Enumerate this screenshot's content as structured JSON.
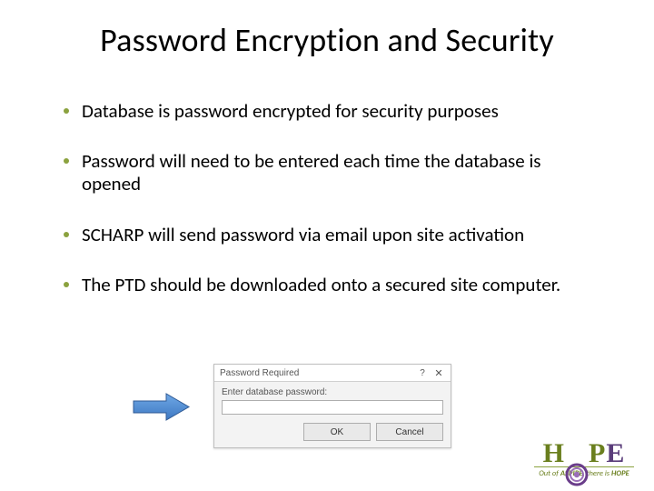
{
  "title": "Password Encryption and Security",
  "bullets": [
    "Database is password encrypted for security purposes",
    "Password will need to be entered each time the database is opened",
    "SCHARP will send password via email upon site activation",
    "The PTD should be downloaded onto a secured site computer."
  ],
  "dialog": {
    "title": "Password Required",
    "label": "Enter database password:",
    "ok": "OK",
    "cancel": "Cancel"
  },
  "logo": {
    "word_h": "H",
    "word_p": "P",
    "word_e": "E",
    "tagline_prefix": "Out of ",
    "tagline_em1": "ASPIRE",
    "tagline_mid": ", there is ",
    "tagline_em2": "HOPE"
  }
}
